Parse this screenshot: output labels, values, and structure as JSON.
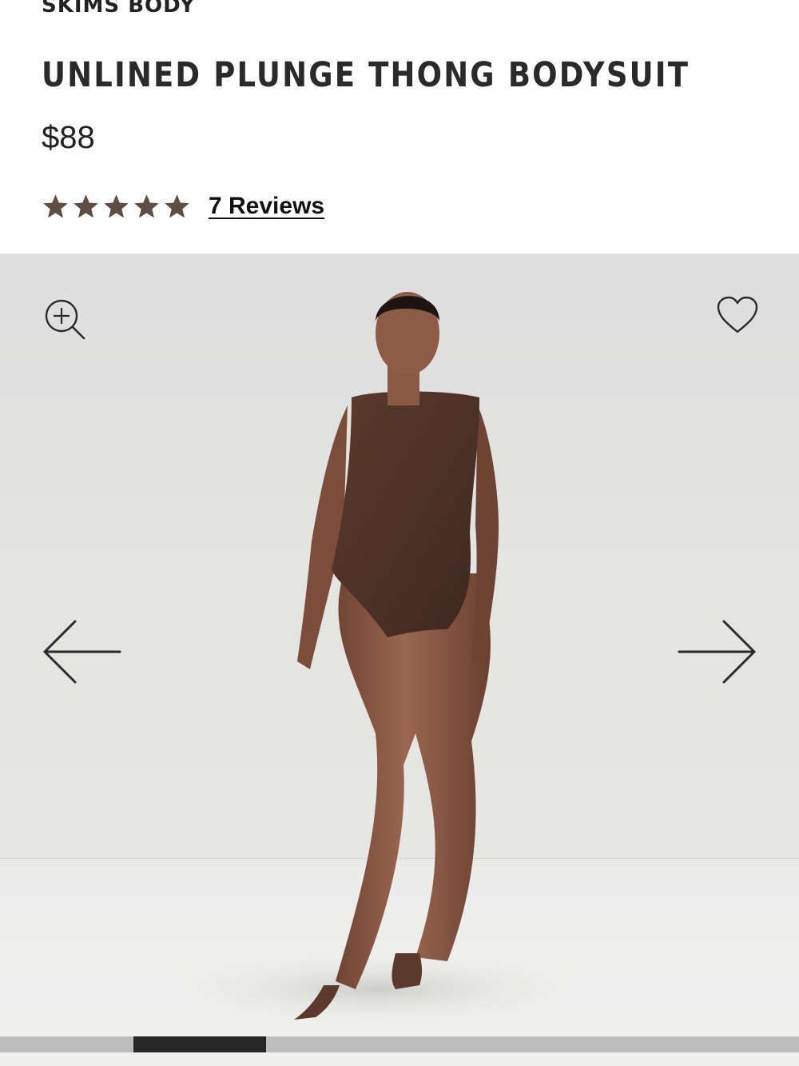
{
  "product": {
    "brand": "SKIMS BODY",
    "title": "UNLINED PLUNGE THONG BODYSUIT",
    "price": "$88",
    "rating": 5,
    "reviews_label": "7 Reviews"
  },
  "gallery": {
    "icons": {
      "zoom": "zoom-in-icon",
      "favorite": "heart-icon",
      "previous": "arrow-left-icon",
      "next": "arrow-right-icon"
    },
    "image_count": 6,
    "current_image": 2
  },
  "colors": {
    "star": "#5e4d43",
    "text": "#222222",
    "progress_active": "#262626",
    "progress_track": "#bdbdbd"
  }
}
